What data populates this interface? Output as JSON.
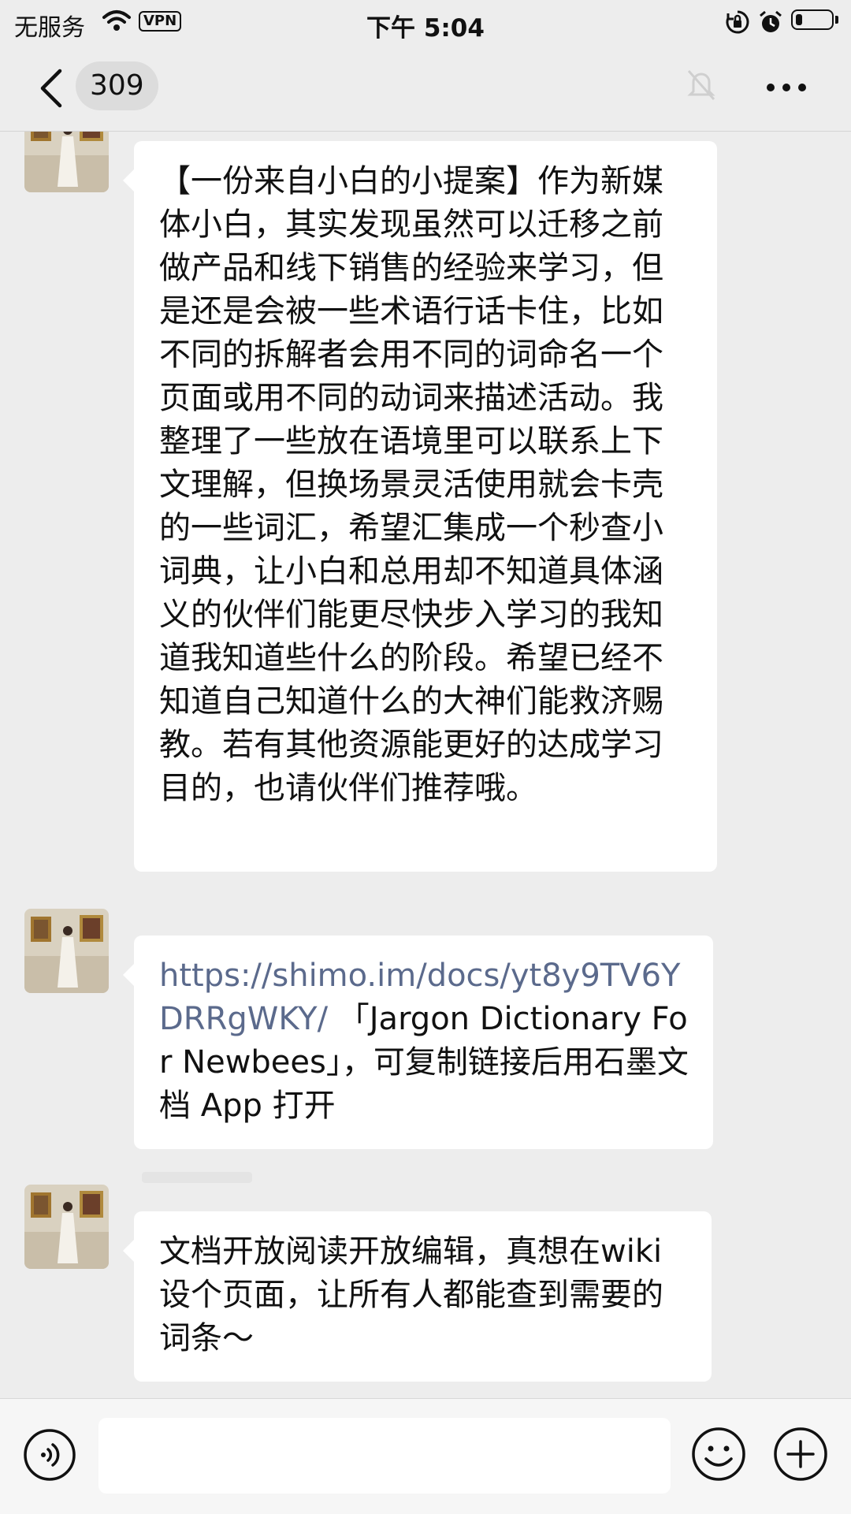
{
  "status_bar": {
    "carrier": "无服务",
    "vpn": "VPN",
    "time": "下午 5:04"
  },
  "header": {
    "unread_count": "309"
  },
  "messages": [
    {
      "text": "【一份来自小白的小提案】作为新媒体小白，其实发现虽然可以迁移之前做产品和线下销售的经验来学习，但是还是会被一些术语行话卡住，比如不同的拆解者会用不同的词命名一个页面或用不同的动词来描述活动。我整理了一些放在语境里可以联系上下文理解，但换场景灵活使用就会卡壳的一些词汇，希望汇集成一个秒查小词典，让小白和总用却不知道具体涵义的伙伴们能更尽快步入学习的我知道我知道些什么的阶段。希望已经不知道自己知道什么的大神们能救济赐教。若有其他资源能更好的达成学习目的，也请伙伴们推荐哦。"
    },
    {
      "link": "https://shimo.im/docs/yt8y9TV6YDRRgWKY/",
      "text": " 「Jargon Dictionary For Newbees」，可复制链接后用石墨文档 App 打开"
    },
    {
      "text": "文档开放阅读开放编辑，真想在wiki设个页面，让所有人都能查到需要的词条～"
    }
  ],
  "input": {
    "placeholder": ""
  },
  "colors": {
    "background": "#ededed",
    "bubble": "#ffffff",
    "link": "#5b6a8c"
  }
}
